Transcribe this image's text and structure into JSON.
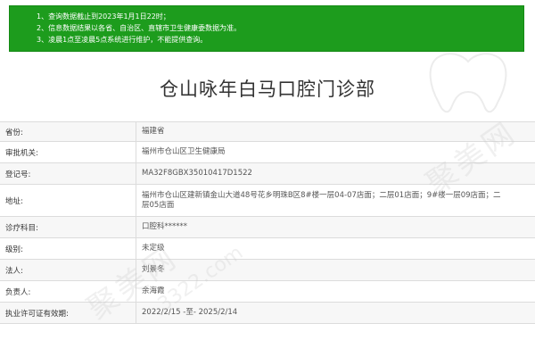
{
  "notice": {
    "lines": [
      "1、查询数据截止到2023年1月1日22时；",
      "2、信息数据结果以各省、自治区、直辖市卫生健康委数据为准。",
      "3、凌晨1点至凌晨5点系统进行维护，不能提供查询。"
    ]
  },
  "page_title": "仓山咏年白马口腔门诊部",
  "info": {
    "rows": [
      {
        "label": "省份:",
        "value": "福建省"
      },
      {
        "label": "审批机关:",
        "value": "福州市仓山区卫生健康局"
      },
      {
        "label": "登记号:",
        "value": "MA32F8GBX35010417D1522"
      },
      {
        "label": "地址:",
        "value": "福州市仓山区建新镇金山大道48号花乡明珠B区8#楼一层04-07店面；二层01店面；9#楼一层09店面；二层05店面"
      },
      {
        "label": "诊疗科目:",
        "value": "口腔科******"
      },
      {
        "label": "级别:",
        "value": "未定级"
      },
      {
        "label": "法人:",
        "value": "刘景冬"
      },
      {
        "label": "负责人:",
        "value": "余海霞"
      },
      {
        "label": "执业许可证有效期:",
        "value": "2022/2/15 -至- 2025/2/14"
      }
    ]
  },
  "watermark": {
    "text": "聚美网",
    "subtext": "3322.com"
  }
}
